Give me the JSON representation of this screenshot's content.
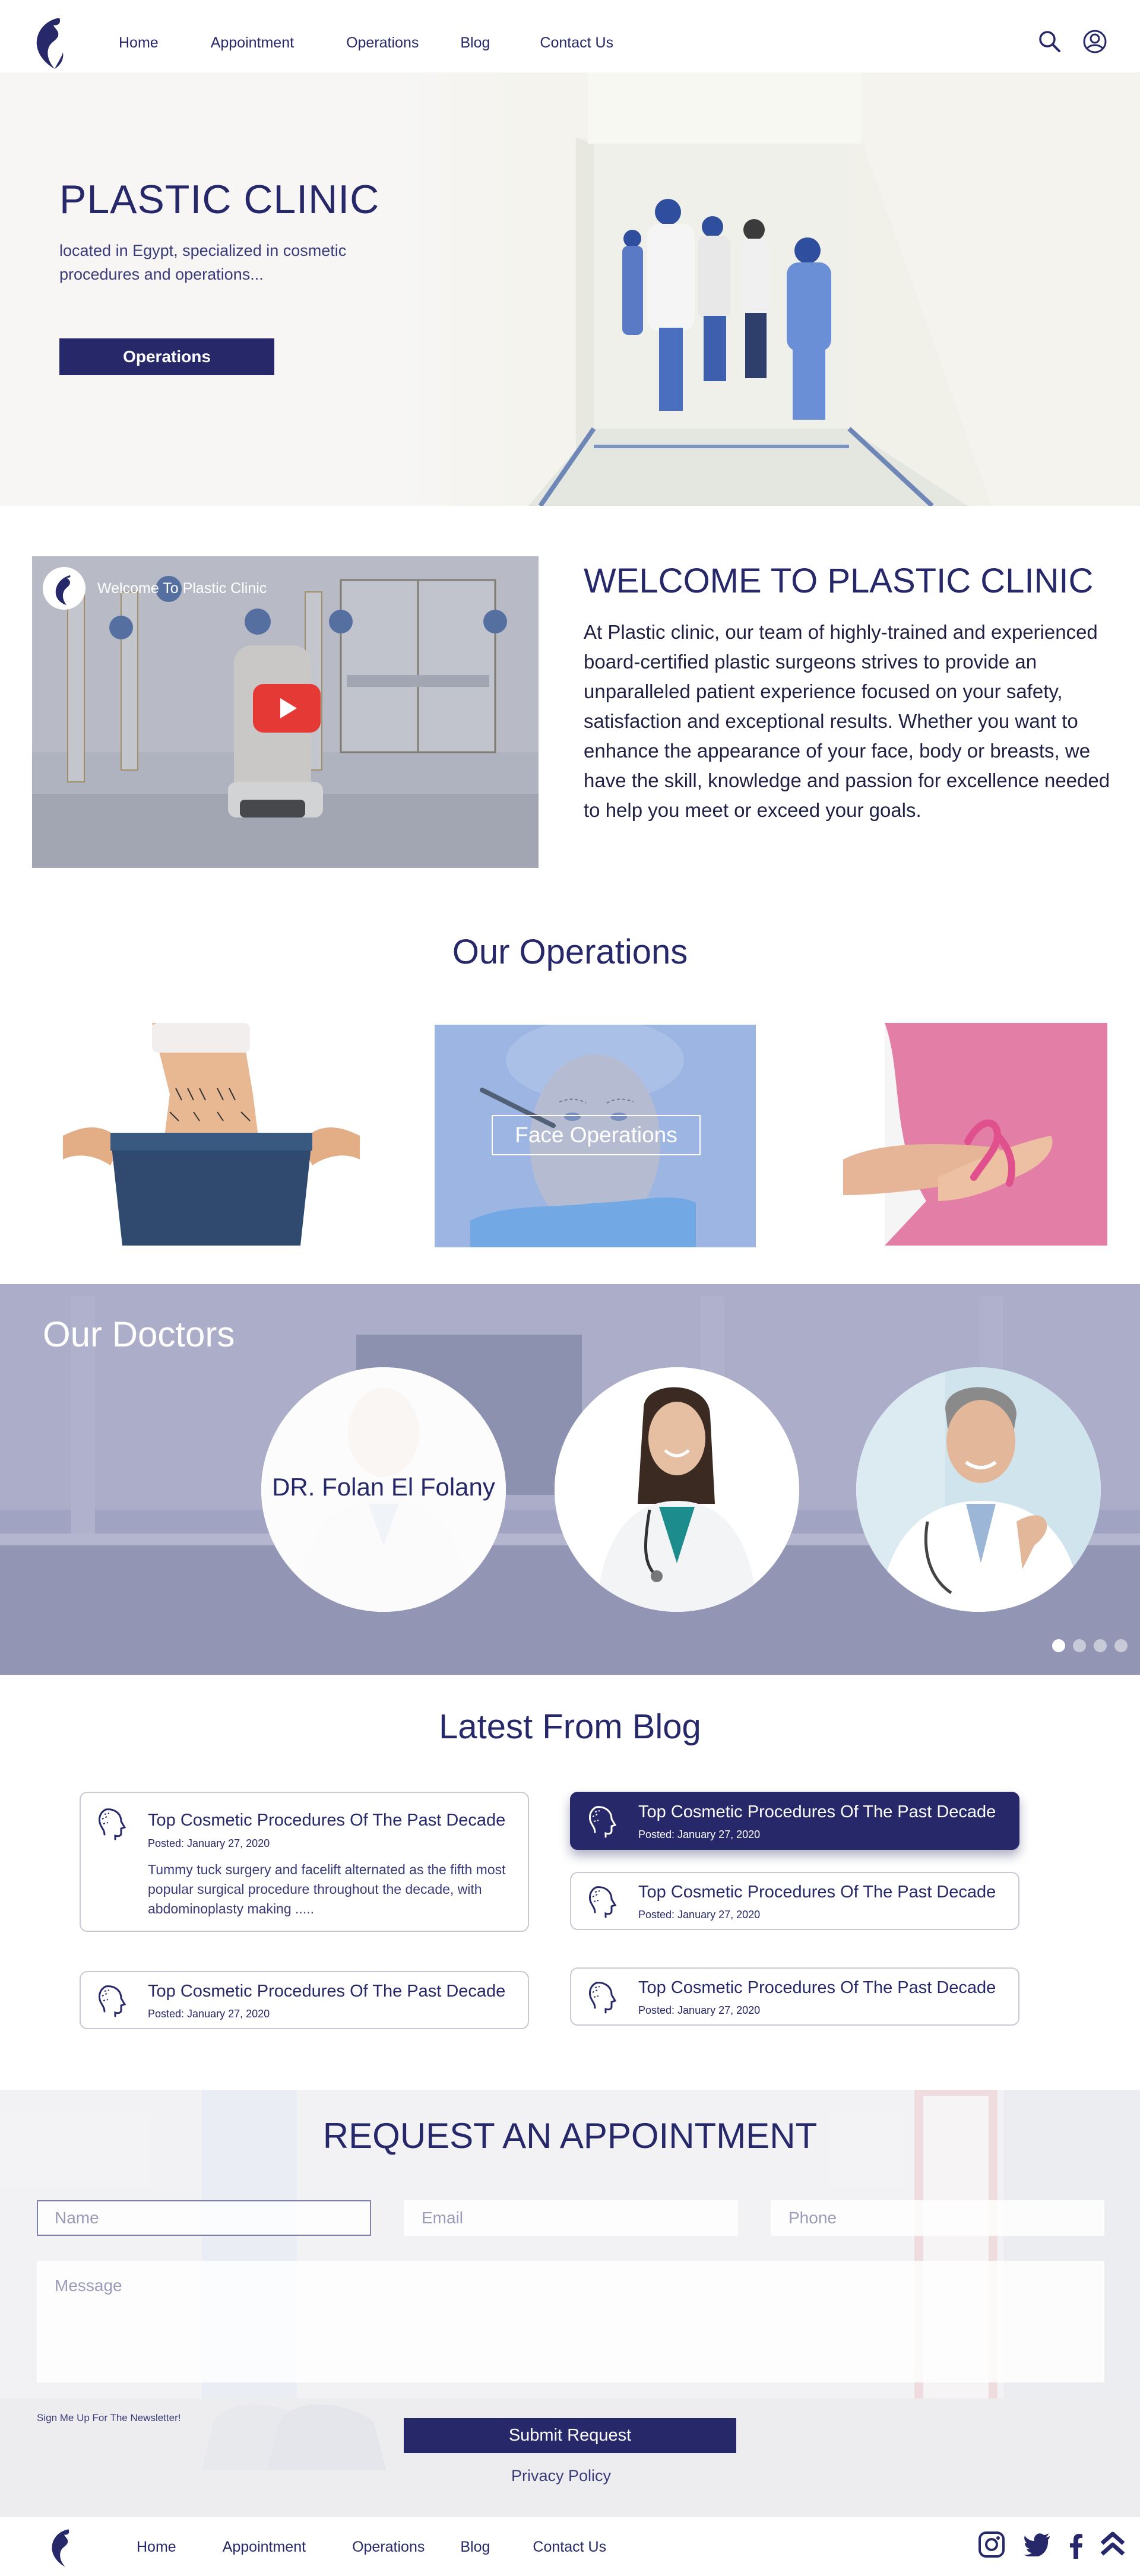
{
  "nav": {
    "items": [
      "Home",
      "Appointment",
      "Operations",
      "Blog",
      "Contact Us"
    ]
  },
  "hero": {
    "title": "PLASTIC CLINIC",
    "subtitle": "located in Egypt, specialized in cosmetic procedures and operations...",
    "button_label": "Operations"
  },
  "welcome": {
    "video_title": "Welcome To Plastic Clinic",
    "title": "WELCOME TO PLASTIC CLINIC",
    "text": "At Plastic clinic, our team of highly-trained and experienced board-certified plastic surgeons strives to provide an unparalleled patient experience focused on your safety, satisfaction and exceptional results. Whether you want to enhance the appearance of your face, body or breasts, we have the skill, knowledge and passion for excellence needed to help you meet or exceed your goals."
  },
  "operations": {
    "title": "Our Operations",
    "hover_label": "Face Operations"
  },
  "doctors": {
    "title": "Our Doctors",
    "featured_name": "DR. Folan El Folany",
    "active_dot": 1,
    "dot_count": 4
  },
  "blog": {
    "title": "Latest From Blog",
    "posts": [
      {
        "title": "Top Cosmetic Procedures Of The Past Decade",
        "date": "Posted: January 27, 2020",
        "excerpt": "Tummy tuck surgery and facelift alternated as the fifth most popular surgical procedure throughout the decade, with abdominoplasty making ....."
      },
      {
        "title": "Top Cosmetic Procedures Of The Past Decade",
        "date": "Posted: January 27, 2020"
      },
      {
        "title": "Top Cosmetic Procedures Of The Past Decade",
        "date": "Posted: January 27, 2020"
      },
      {
        "title": "Top Cosmetic Procedures Of The Past Decade",
        "date": "Posted: January 27, 2020"
      },
      {
        "title": "Top Cosmetic Procedures Of The Past Decade",
        "date": "Posted: January 27, 2020"
      }
    ]
  },
  "appointment": {
    "title": "REQUEST AN APPOINTMENT",
    "name_placeholder": "Name",
    "email_placeholder": "Email",
    "phone_placeholder": "Phone",
    "message_placeholder": "Message",
    "newsletter_label": "Sign Me Up For The Newsletter!",
    "submit_label": "Submit Request",
    "privacy_label": "Privacy Policy"
  },
  "footer": {
    "items": [
      "Home",
      "Appointment",
      "Operations",
      "Blog",
      "Contact Us"
    ],
    "social": [
      "instagram-icon",
      "twitter-icon",
      "facebook-icon",
      "scroll-top-icon"
    ]
  },
  "colors": {
    "brand": "#26286a",
    "active_blog": "#26286a",
    "play_button": "#e53935"
  }
}
